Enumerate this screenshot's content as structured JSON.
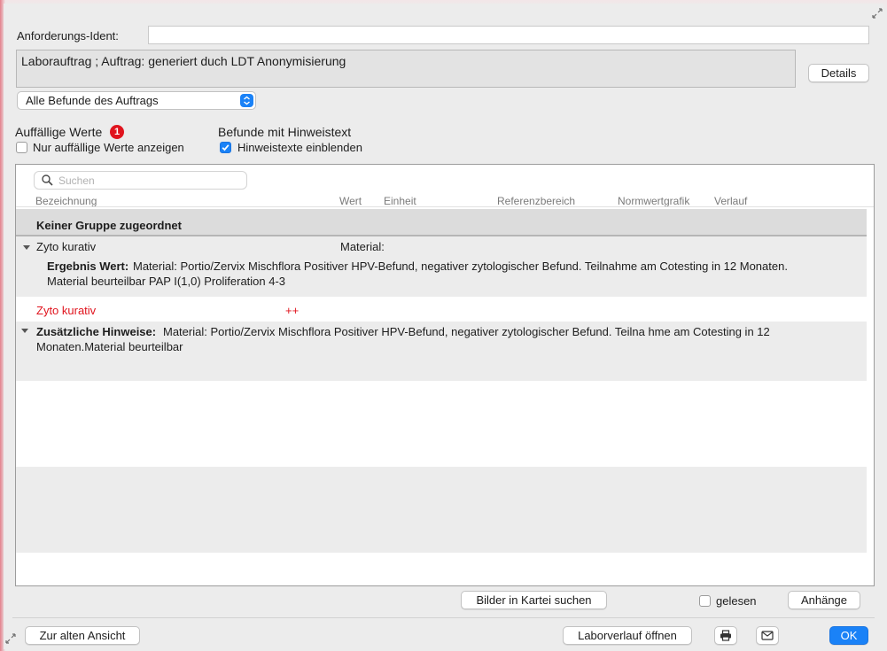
{
  "header": {
    "ident_label": "Anforderungs-Ident:",
    "ident_value": "",
    "auftrag_text": "Laborauftrag ; Auftrag: generiert duch LDT Anonymisierung",
    "details_button": "Details"
  },
  "filter": {
    "selected": "Alle Befunde des Auftrags"
  },
  "options": {
    "auffaellige_title": "Auffällige Werte",
    "auffaellige_count": "1",
    "auffaellige_checkbox": "Nur auffällige Werte anzeigen",
    "auffaellige_checked": false,
    "hinweis_title": "Befunde mit Hinweistext",
    "hinweis_checkbox": "Hinweistexte einblenden",
    "hinweis_checked": true
  },
  "table": {
    "search_placeholder": "Suchen",
    "columns": [
      "Bezeichnung",
      "Wert",
      "Einheit",
      "Referenzbereich",
      "Normwertgrafik",
      "Verlauf"
    ],
    "group_header": "Keiner Gruppe zugeordnet",
    "rows": [
      {
        "name": "Zyto kurativ",
        "wert": "Material:",
        "detail_label": "Ergebnis Wert:",
        "detail_text_1": "Material: Portio/Zervix Mischflora Positiver HPV-Befund, negativer zytologischer Befund.  Teilnahme am Cotesting in 12 Monaten.",
        "detail_text_2": "Material beurteilbar PAP I(1,0) Proliferation 4-3"
      },
      {
        "name": "Zyto kurativ",
        "wert": "++"
      }
    ],
    "hint_label": "Zusätzliche Hinweise:",
    "hint_text_1": "Material: Portio/Zervix Mischflora Positiver HPV-Befund, negativer zytologischer Befund. Teilna hme am Cotesting in 12",
    "hint_text_2": "Monaten.Material beurteilbar"
  },
  "footer": {
    "bilder_button": "Bilder in Kartei suchen",
    "gelesen_label": "gelesen",
    "gelesen_checked": false,
    "anhaenge_button": "Anhänge",
    "alte_ansicht_button": "Zur alten Ansicht",
    "laborverlauf_button": "Laborverlauf öffnen",
    "ok_button": "OK"
  },
  "icons": {
    "resize_top": "expand-arrows-icon",
    "resize_bottom": "resize-grip-icon",
    "print": "printer-icon",
    "mail": "envelope-icon",
    "search": "magnifier-icon",
    "popup": "chevron-updown-icon"
  },
  "colors": {
    "accent": "#1a82f7",
    "alert": "#e0141e"
  }
}
